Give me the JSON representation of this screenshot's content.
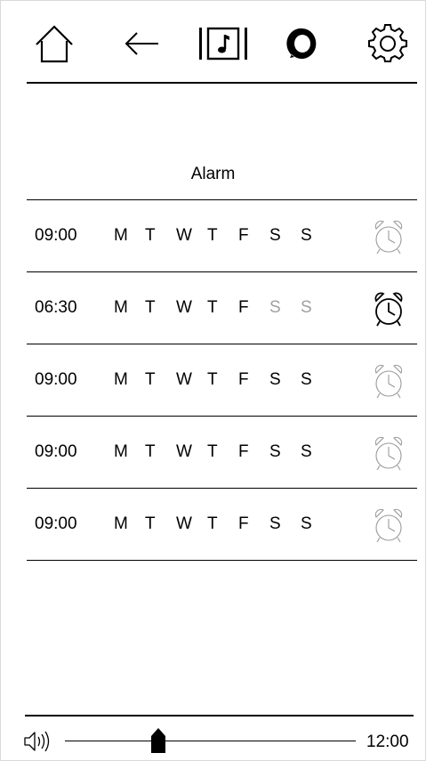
{
  "toolbar": {
    "icons": [
      "home-icon",
      "back-arrow-icon",
      "music-library-icon",
      "alexa-icon",
      "gear-icon"
    ]
  },
  "page": {
    "title": "Alarm"
  },
  "alarms": [
    {
      "time": "09:00",
      "days": [
        "M",
        "T",
        "W",
        "T",
        "F",
        "S",
        "S"
      ],
      "dim_days": [
        false,
        false,
        false,
        false,
        false,
        false,
        false
      ],
      "enabled": false
    },
    {
      "time": "06:30",
      "days": [
        "M",
        "T",
        "W",
        "T",
        "F",
        "S",
        "S"
      ],
      "dim_days": [
        false,
        false,
        false,
        false,
        false,
        true,
        true
      ],
      "enabled": true
    },
    {
      "time": "09:00",
      "days": [
        "M",
        "T",
        "W",
        "T",
        "F",
        "S",
        "S"
      ],
      "dim_days": [
        false,
        false,
        false,
        false,
        false,
        false,
        false
      ],
      "enabled": false
    },
    {
      "time": "09:00",
      "days": [
        "M",
        "T",
        "W",
        "T",
        "F",
        "S",
        "S"
      ],
      "dim_days": [
        false,
        false,
        false,
        false,
        false,
        false,
        false
      ],
      "enabled": false
    },
    {
      "time": "09:00",
      "days": [
        "M",
        "T",
        "W",
        "T",
        "F",
        "S",
        "S"
      ],
      "dim_days": [
        false,
        false,
        false,
        false,
        false,
        false,
        false
      ],
      "enabled": false
    }
  ],
  "footer": {
    "volume_icon": "speaker-icon",
    "volume_level": 0.32,
    "clock": "12:00"
  },
  "colors": {
    "active": "#000000",
    "inactive": "#9a9a9a"
  }
}
